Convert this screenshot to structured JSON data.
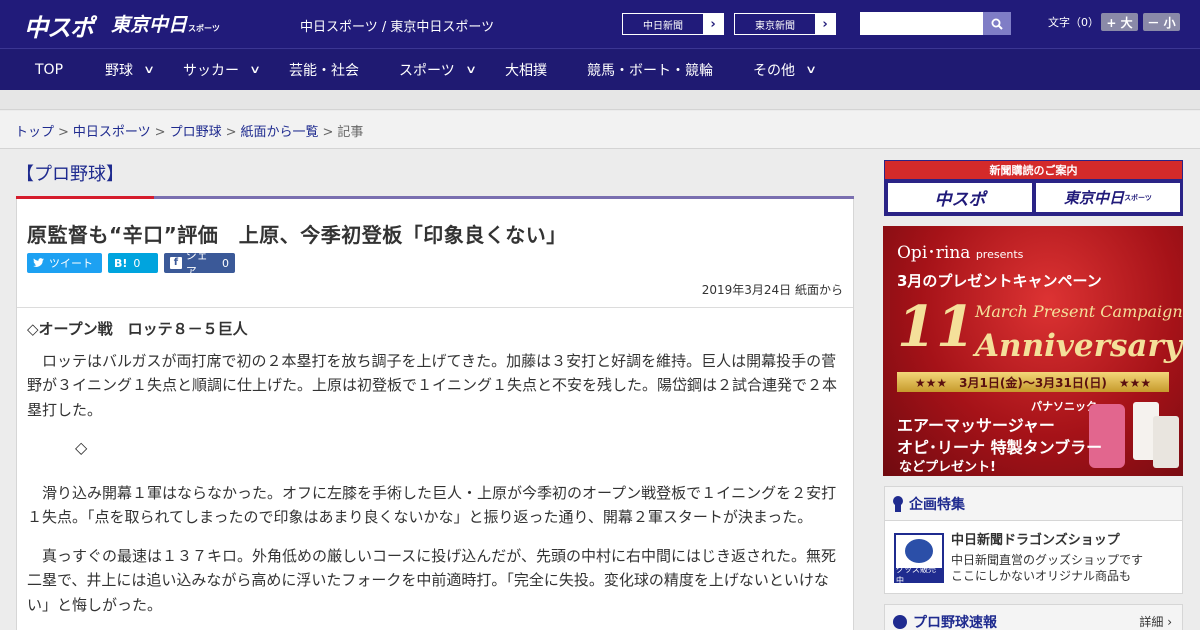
{
  "header": {
    "logo_chuspo": "中スポ",
    "logo_tokyo": "東京中日",
    "logo_tokyo_small": "スポーツ",
    "site_names": "中日スポーツ / 東京中日スポーツ",
    "links": [
      {
        "label": "中日新聞",
        "arrow": "›"
      },
      {
        "label": "東京新聞",
        "arrow": "›"
      }
    ],
    "search": {
      "placeholder": "",
      "value": ""
    },
    "font_size_label": "文字（0）",
    "font_larger": "+ 大",
    "font_smaller": "－ 小"
  },
  "nav": {
    "items": [
      {
        "label": "TOP",
        "chevron": ""
      },
      {
        "label": "野球",
        "chevron": "∨"
      },
      {
        "label": "サッカー",
        "chevron": "∨"
      },
      {
        "label": "芸能・社会",
        "chevron": ""
      },
      {
        "label": "スポーツ",
        "chevron": "∨"
      },
      {
        "label": "大相撲",
        "chevron": ""
      },
      {
        "label": "競馬・ボート・競輪",
        "chevron": ""
      },
      {
        "label": "その他",
        "chevron": "∨"
      }
    ]
  },
  "breadcrumb": {
    "items": [
      "トップ",
      "中日スポーツ",
      "プロ野球",
      "紙面から一覧"
    ],
    "current": "記事",
    "separator": ">"
  },
  "article": {
    "section": "【プロ野球】",
    "headline": "原監督も“辛口”評価　上原、今季初登板「印象良くない」",
    "share": {
      "tweet": "ツイート",
      "hatena_label": "B!",
      "hatena_count": "0",
      "fb_label": "シェア",
      "fb_count": "0"
    },
    "date": "2019年3月24日 紙面から",
    "lead": "◇オープン戦　ロッテ８－５巨人",
    "paragraph1": "ロッテはバルガスが両打席で初の２本塁打を放ち調子を上げてきた。加藤は３安打と好調を維持。巨人は開幕投手の菅野が３イニング１失点と順調に仕上げた。上原は初登板で１イニング１失点と不安を残した。陽岱鋼は２試合連発で２本塁打した。",
    "divider": "◇",
    "paragraph2": "滑り込み開幕１軍はならなかった。オフに左膝を手術した巨人・上原が今季初のオープン戦登板で１イニングを２安打１失点。「点を取られてしまったので印象はあまり良くないかな」と振り返った通り、開幕２軍スタートが決まった。",
    "paragraph3": "真っすぐの最速は１３７キロ。外角低めの厳しいコースに投げ込んだが、先頭の中村に右中間にはじき返された。無死二塁で、井上には追い込みながら高めに浮いたフォークを中前適時打。「完全に失投。変化球の精度を上げないといけない」と悔しがった。"
  },
  "sidebar": {
    "subscription": {
      "heading": "新聞購読のご案内",
      "left": "中スポ",
      "right": "東京中日",
      "right_small": "スポーツ"
    },
    "ad": {
      "brand": "Opi･rina",
      "brand_suffix": "presents",
      "campaign": "3月のプレゼントキャンペーン",
      "number": "11",
      "script_line": "March Present Campaign",
      "anniversary": "Anniversary",
      "dates": "★★★　3月1日(金)～3月31日(日)　★★★",
      "line1": "パナソニック",
      "line2": "エアーマッサージャー",
      "line3": "オピ･リーナ 特製タンブラー",
      "line4": "などプレゼント!"
    },
    "feature": {
      "heading": "企画特集",
      "title": "中日新聞ドラゴンズショップ",
      "desc1": "中日新聞直営のグッズショップです",
      "desc2": "ここにしかないオリジナル商品も",
      "thumb_tag": "グッズ販売中"
    },
    "news": {
      "heading": "プロ野球速報",
      "detail": "詳細 ›"
    }
  },
  "colors": {
    "header_bg": "#211b7a",
    "nav_bg": "#1f1a72",
    "accent_red": "#d51c2c",
    "link_blue": "#1f2b8f",
    "twitter": "#1da1f2",
    "hatena": "#00a4de",
    "facebook": "#3b5998"
  }
}
